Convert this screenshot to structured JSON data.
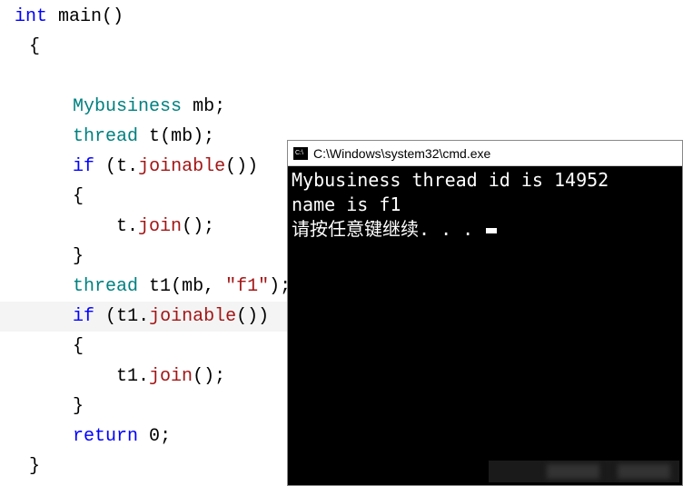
{
  "code": {
    "lines": [
      {
        "indent": 0,
        "tokens": [
          {
            "t": "box",
            "v": "▫"
          },
          {
            "t": "kw-type",
            "v": "int"
          },
          {
            "t": "sp",
            "v": " "
          },
          {
            "t": "identifier",
            "v": "main"
          },
          {
            "t": "paren",
            "v": "()"
          }
        ]
      },
      {
        "indent": 1,
        "tokens": [
          {
            "t": "brace",
            "v": "{"
          }
        ]
      },
      {
        "indent": 0,
        "tokens": [
          {
            "t": "sp",
            "v": ""
          }
        ]
      },
      {
        "indent": 5,
        "tokens": [
          {
            "t": "class-name",
            "v": "Mybusiness"
          },
          {
            "t": "sp",
            "v": " "
          },
          {
            "t": "identifier",
            "v": "mb"
          },
          {
            "t": "semi",
            "v": ";"
          }
        ]
      },
      {
        "indent": 5,
        "tokens": [
          {
            "t": "class-name",
            "v": "thread"
          },
          {
            "t": "sp",
            "v": " "
          },
          {
            "t": "identifier",
            "v": "t"
          },
          {
            "t": "paren",
            "v": "("
          },
          {
            "t": "identifier",
            "v": "mb"
          },
          {
            "t": "paren",
            "v": ")"
          },
          {
            "t": "semi",
            "v": ";"
          }
        ]
      },
      {
        "indent": 5,
        "tokens": [
          {
            "t": "kw-flow",
            "v": "if"
          },
          {
            "t": "sp",
            "v": " "
          },
          {
            "t": "paren",
            "v": "("
          },
          {
            "t": "identifier",
            "v": "t."
          },
          {
            "t": "method",
            "v": "joinable"
          },
          {
            "t": "paren",
            "v": "())"
          }
        ]
      },
      {
        "indent": 5,
        "tokens": [
          {
            "t": "brace",
            "v": "{"
          }
        ]
      },
      {
        "indent": 9,
        "tokens": [
          {
            "t": "identifier",
            "v": "t."
          },
          {
            "t": "method",
            "v": "join"
          },
          {
            "t": "paren",
            "v": "()"
          },
          {
            "t": "semi",
            "v": ";"
          }
        ]
      },
      {
        "indent": 5,
        "tokens": [
          {
            "t": "brace",
            "v": "}"
          }
        ]
      },
      {
        "indent": 5,
        "tokens": [
          {
            "t": "class-name",
            "v": "thread"
          },
          {
            "t": "sp",
            "v": " "
          },
          {
            "t": "identifier",
            "v": "t1"
          },
          {
            "t": "paren",
            "v": "("
          },
          {
            "t": "identifier",
            "v": "mb"
          },
          {
            "t": "paren",
            "v": ", "
          },
          {
            "t": "string",
            "v": "\"f1\""
          },
          {
            "t": "paren",
            "v": ")"
          },
          {
            "t": "semi",
            "v": ";"
          }
        ]
      },
      {
        "indent": 5,
        "highlighted": true,
        "tokens": [
          {
            "t": "kw-flow",
            "v": "if"
          },
          {
            "t": "sp",
            "v": " "
          },
          {
            "t": "paren",
            "v": "("
          },
          {
            "t": "identifier",
            "v": "t1."
          },
          {
            "t": "method",
            "v": "joinable"
          },
          {
            "t": "paren",
            "v": "())"
          }
        ]
      },
      {
        "indent": 5,
        "tokens": [
          {
            "t": "brace",
            "v": "{"
          }
        ]
      },
      {
        "indent": 9,
        "tokens": [
          {
            "t": "identifier",
            "v": "t1."
          },
          {
            "t": "method",
            "v": "join"
          },
          {
            "t": "paren",
            "v": "()"
          },
          {
            "t": "semi",
            "v": ";"
          }
        ]
      },
      {
        "indent": 5,
        "tokens": [
          {
            "t": "brace",
            "v": "}"
          }
        ]
      },
      {
        "indent": 5,
        "tokens": [
          {
            "t": "kw-flow",
            "v": "return"
          },
          {
            "t": "sp",
            "v": " "
          },
          {
            "t": "number",
            "v": "0"
          },
          {
            "t": "semi",
            "v": ";"
          }
        ]
      },
      {
        "indent": 1,
        "tokens": [
          {
            "t": "brace",
            "v": "}"
          }
        ]
      }
    ]
  },
  "console": {
    "title": "C:\\Windows\\system32\\cmd.exe",
    "lines": [
      "Mybusiness thread id is 14952",
      "name is f1",
      "请按任意键继续. . . "
    ]
  }
}
